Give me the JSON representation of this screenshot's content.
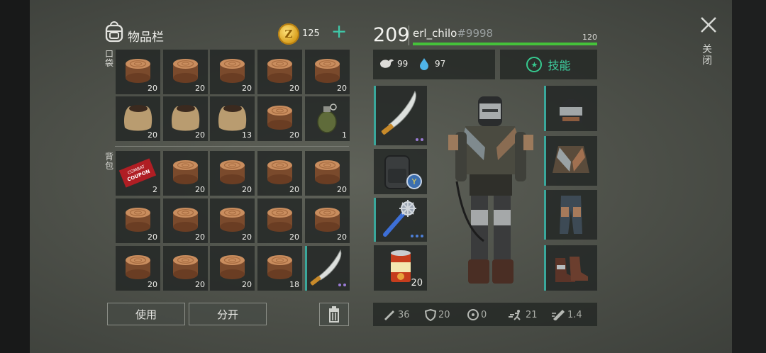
{
  "inventory": {
    "title": "物品栏",
    "coins": "125",
    "add_label": "+",
    "pocket_label": "口袋",
    "backpack_label": "背包",
    "pocket_slots": [
      {
        "icon": "wood-log-icon",
        "count": "20"
      },
      {
        "icon": "wood-log-icon",
        "count": "20"
      },
      {
        "icon": "wood-log-icon",
        "count": "20"
      },
      {
        "icon": "wood-log-icon",
        "count": "20"
      },
      {
        "icon": "wood-log-icon",
        "count": "20"
      },
      {
        "icon": "soil-sack-icon",
        "count": "20"
      },
      {
        "icon": "soil-sack-icon",
        "count": "20"
      },
      {
        "icon": "soil-sack-icon",
        "count": "13"
      },
      {
        "icon": "wood-log-icon",
        "count": "20"
      },
      {
        "icon": "grenade-icon",
        "count": "1"
      }
    ],
    "backpack_slots": [
      {
        "icon": "coupon-icon",
        "count": "2"
      },
      {
        "icon": "wood-log-icon",
        "count": "20"
      },
      {
        "icon": "wood-log-icon",
        "count": "20"
      },
      {
        "icon": "wood-log-icon",
        "count": "20"
      },
      {
        "icon": "wood-log-icon",
        "count": "20"
      },
      {
        "icon": "wood-log-icon",
        "count": "20"
      },
      {
        "icon": "wood-log-icon",
        "count": "20"
      },
      {
        "icon": "wood-log-icon",
        "count": "20"
      },
      {
        "icon": "wood-log-icon",
        "count": "20"
      },
      {
        "icon": "wood-log-icon",
        "count": "20"
      },
      {
        "icon": "wood-log-icon",
        "count": "20"
      },
      {
        "icon": "wood-log-icon",
        "count": "20"
      },
      {
        "icon": "wood-log-icon",
        "count": "20"
      },
      {
        "icon": "wood-log-icon",
        "count": "18"
      },
      {
        "icon": "machete-icon",
        "count": ""
      }
    ],
    "coupon_text_1": "COMBAT",
    "coupon_text_2": "COUPON",
    "use_label": "使用",
    "split_label": "分开"
  },
  "player": {
    "level": "209",
    "name": "erl_chilo",
    "tag": "#9998",
    "xp_max": "120",
    "xp_fraction": 1.0,
    "food": "99",
    "water": "97",
    "skills_label": "技能"
  },
  "equipment": {
    "weapon_count": "",
    "food_count": "20",
    "food_can_label": "FOOD"
  },
  "combat_stats": {
    "attack": "36",
    "armor": "20",
    "radiation": "0",
    "speed": "21",
    "attack_speed": "1.4"
  },
  "close_label": "关闭",
  "colors": {
    "accent": "#3fc9a9",
    "xp_green": "#45c23a",
    "slot_marker": "#3aa79b"
  }
}
